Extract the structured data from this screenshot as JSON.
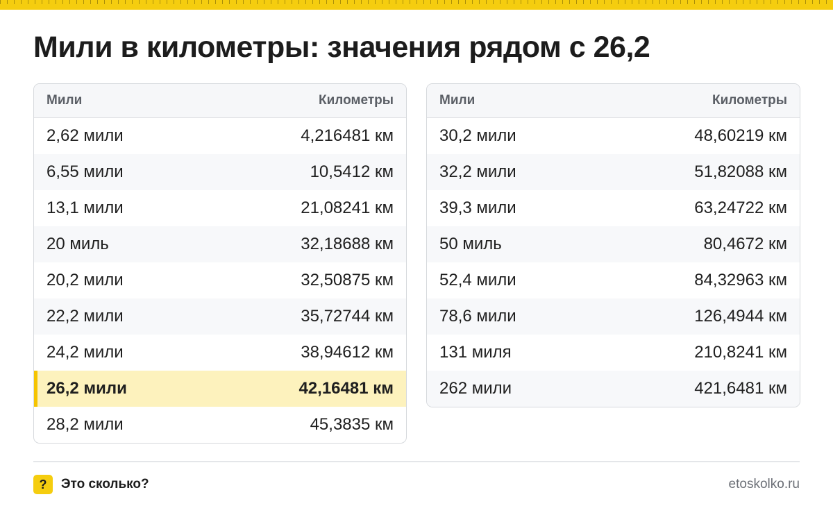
{
  "title": "Мили в километры: значения рядом с 26,2",
  "colors": {
    "accent": "#f5cd0f",
    "highlight_bg": "#fdf2bd",
    "border": "#d6d9dd"
  },
  "tables": [
    {
      "header": {
        "miles": "Мили",
        "km": "Километры"
      },
      "rows": [
        {
          "miles": "2,62 мили",
          "km": "4,216481 км"
        },
        {
          "miles": "6,55 мили",
          "km": "10,5412 км"
        },
        {
          "miles": "13,1 мили",
          "km": "21,08241 км"
        },
        {
          "miles": "20 миль",
          "km": "32,18688 км"
        },
        {
          "miles": "20,2 мили",
          "km": "32,50875 км"
        },
        {
          "miles": "22,2 мили",
          "km": "35,72744 км"
        },
        {
          "miles": "24,2 мили",
          "km": "38,94612 км"
        },
        {
          "miles": "26,2 мили",
          "km": "42,16481 км",
          "highlighted": true
        },
        {
          "miles": "28,2 мили",
          "km": "45,3835 км"
        }
      ]
    },
    {
      "header": {
        "miles": "Мили",
        "km": "Километры"
      },
      "rows": [
        {
          "miles": "30,2 мили",
          "km": "48,60219 км"
        },
        {
          "miles": "32,2 мили",
          "km": "51,82088 км"
        },
        {
          "miles": "39,3 мили",
          "km": "63,24722 км"
        },
        {
          "miles": "50 миль",
          "km": "80,4672 км"
        },
        {
          "miles": "52,4 мили",
          "km": "84,32963 км"
        },
        {
          "miles": "78,6 мили",
          "km": "126,4944 км"
        },
        {
          "miles": "131 миля",
          "km": "210,8241 км"
        },
        {
          "miles": "262 мили",
          "km": "421,6481 км"
        }
      ]
    }
  ],
  "footer": {
    "badge": "?",
    "brand": "Это сколько?",
    "site": "etoskolko.ru"
  }
}
